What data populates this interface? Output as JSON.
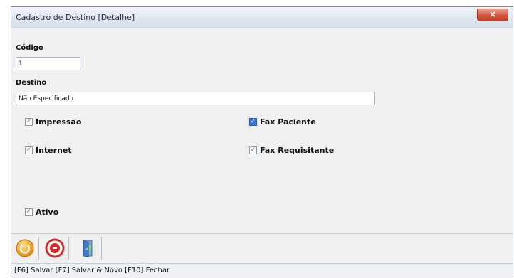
{
  "window": {
    "title": "Cadastro de Destino [Detalhe]",
    "close_glyph": "×"
  },
  "form": {
    "codigo_label": "Código",
    "codigo_value": "1",
    "destino_label": "Destino",
    "destino_value": "Não Especificado",
    "checkboxes": [
      {
        "label": "Impressão",
        "checked": true,
        "style": "gray"
      },
      {
        "label": "Fax Paciente",
        "checked": true,
        "style": "blue"
      },
      {
        "label": "Internet",
        "checked": true,
        "style": "gray"
      },
      {
        "label": "Fax Requisitante",
        "checked": true,
        "style": "gray"
      },
      {
        "label": "Ativo",
        "checked": true,
        "style": "gray"
      }
    ]
  },
  "toolbar": {
    "buttons": [
      "save-icon",
      "cancel-icon",
      "exit-door-icon"
    ]
  },
  "statusbar": {
    "text": "[F6] Salvar [F7] Salvar & Novo [F10] Fechar"
  },
  "colors": {
    "checkbox_blue": "#3a79d6",
    "close_button": "#d2533b",
    "save_icon": "#f2a51f",
    "cancel_icon": "#d42b2b"
  }
}
